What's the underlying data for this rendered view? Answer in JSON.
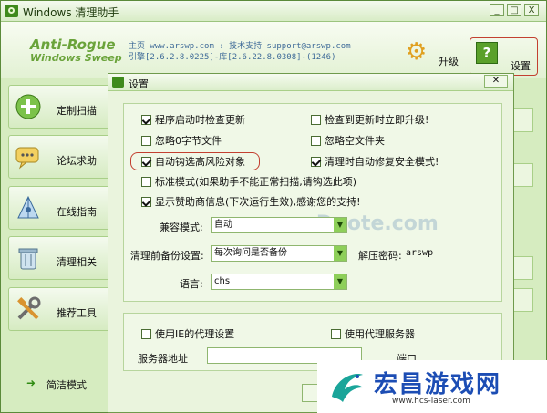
{
  "window": {
    "title": "Windows 清理助手",
    "min_label": "_",
    "max_label": "□",
    "close_label": "X"
  },
  "header": {
    "logo_line1": "Anti-Rogue",
    "logo_line2": "Windows Sweep",
    "info_line1": "主页 www.arswp.com : 技术支持 support@arswp.com",
    "info_line2": "引擎[2.6.2.8.0225]-库[2.6.22.8.0308]-(1246)",
    "upgrade_label": "升级",
    "settings_label": "设置",
    "settings_icon_glyph": "?"
  },
  "sidebar": {
    "items": [
      {
        "label": "定制扫描",
        "icon": "plus-icon"
      },
      {
        "label": "论坛求助",
        "icon": "chat-icon"
      },
      {
        "label": "在线指南",
        "icon": "compass-icon"
      },
      {
        "label": "清理相关",
        "icon": "trash-icon"
      },
      {
        "label": "推荐工具",
        "icon": "tools-icon"
      }
    ],
    "footer_label": "简洁模式",
    "footer_arrow": "➜"
  },
  "dialog": {
    "title": "设置",
    "close_label": "✕",
    "options": {
      "check_update_on_start": {
        "label": "程序启动时检查更新",
        "checked": true
      },
      "upgrade_when_found": {
        "label": "检查到更新时立即升级!",
        "checked": false
      },
      "ignore_zero_byte": {
        "label": "忽略0字节文件",
        "checked": false
      },
      "ignore_empty_folder": {
        "label": "忽略空文件夹",
        "checked": false
      },
      "auto_check_high_risk": {
        "label": "自动钩选高风险对象",
        "checked": true
      },
      "repair_safe_mode": {
        "label": "清理时自动修复安全模式!",
        "checked": true
      },
      "standard_mode": {
        "label": "标准模式(如果助手不能正常扫描,请钩选此项)",
        "checked": false
      },
      "show_sponsor": {
        "label": "显示赞助商信息(下次运行生效),感谢您的支持!",
        "checked": true
      }
    },
    "compat_label": "兼容模式:",
    "compat_value": "自动",
    "backup_label": "清理前备份设置:",
    "backup_value": "每次询问是否备份",
    "unzip_label": "解压密码:",
    "unzip_value": "arswp",
    "language_label": "语言:",
    "language_value": "chs",
    "proxy": {
      "use_ie_proxy": {
        "label": "使用IE的代理设置",
        "checked": false
      },
      "use_proxy_server": {
        "label": "使用代理服务器",
        "checked": false
      },
      "server_label": "服务器地址",
      "port_label": "端口"
    },
    "watermark": "www.Duote.com"
  },
  "brand_overlay": {
    "name": "宏昌游戏网",
    "url": "www.hcs-laser.com"
  },
  "colors": {
    "accent_green": "#5aa02a",
    "highlight_red": "#c34030",
    "info_blue": "#3e6a98",
    "brand_blue": "#1c4db4"
  }
}
